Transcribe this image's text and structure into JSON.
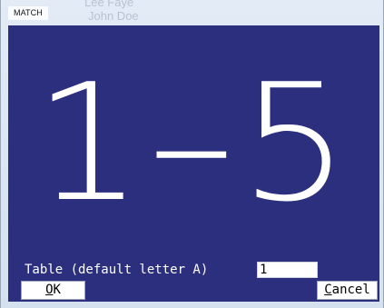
{
  "window": {
    "title": "MATCH",
    "background_text": [
      "Lee Faye",
      "John Doe"
    ]
  },
  "display": {
    "value": "1–5"
  },
  "prompt": {
    "label": "Table (default letter A)",
    "input_value": "1"
  },
  "buttons": {
    "ok": {
      "access_key": "O",
      "rest": "K"
    },
    "cancel": {
      "access_key": "C",
      "rest": "ancel"
    }
  },
  "colors": {
    "panel_background": "#2b2f7d",
    "display_text": "#ffffff",
    "button_background": "#ffffff"
  }
}
